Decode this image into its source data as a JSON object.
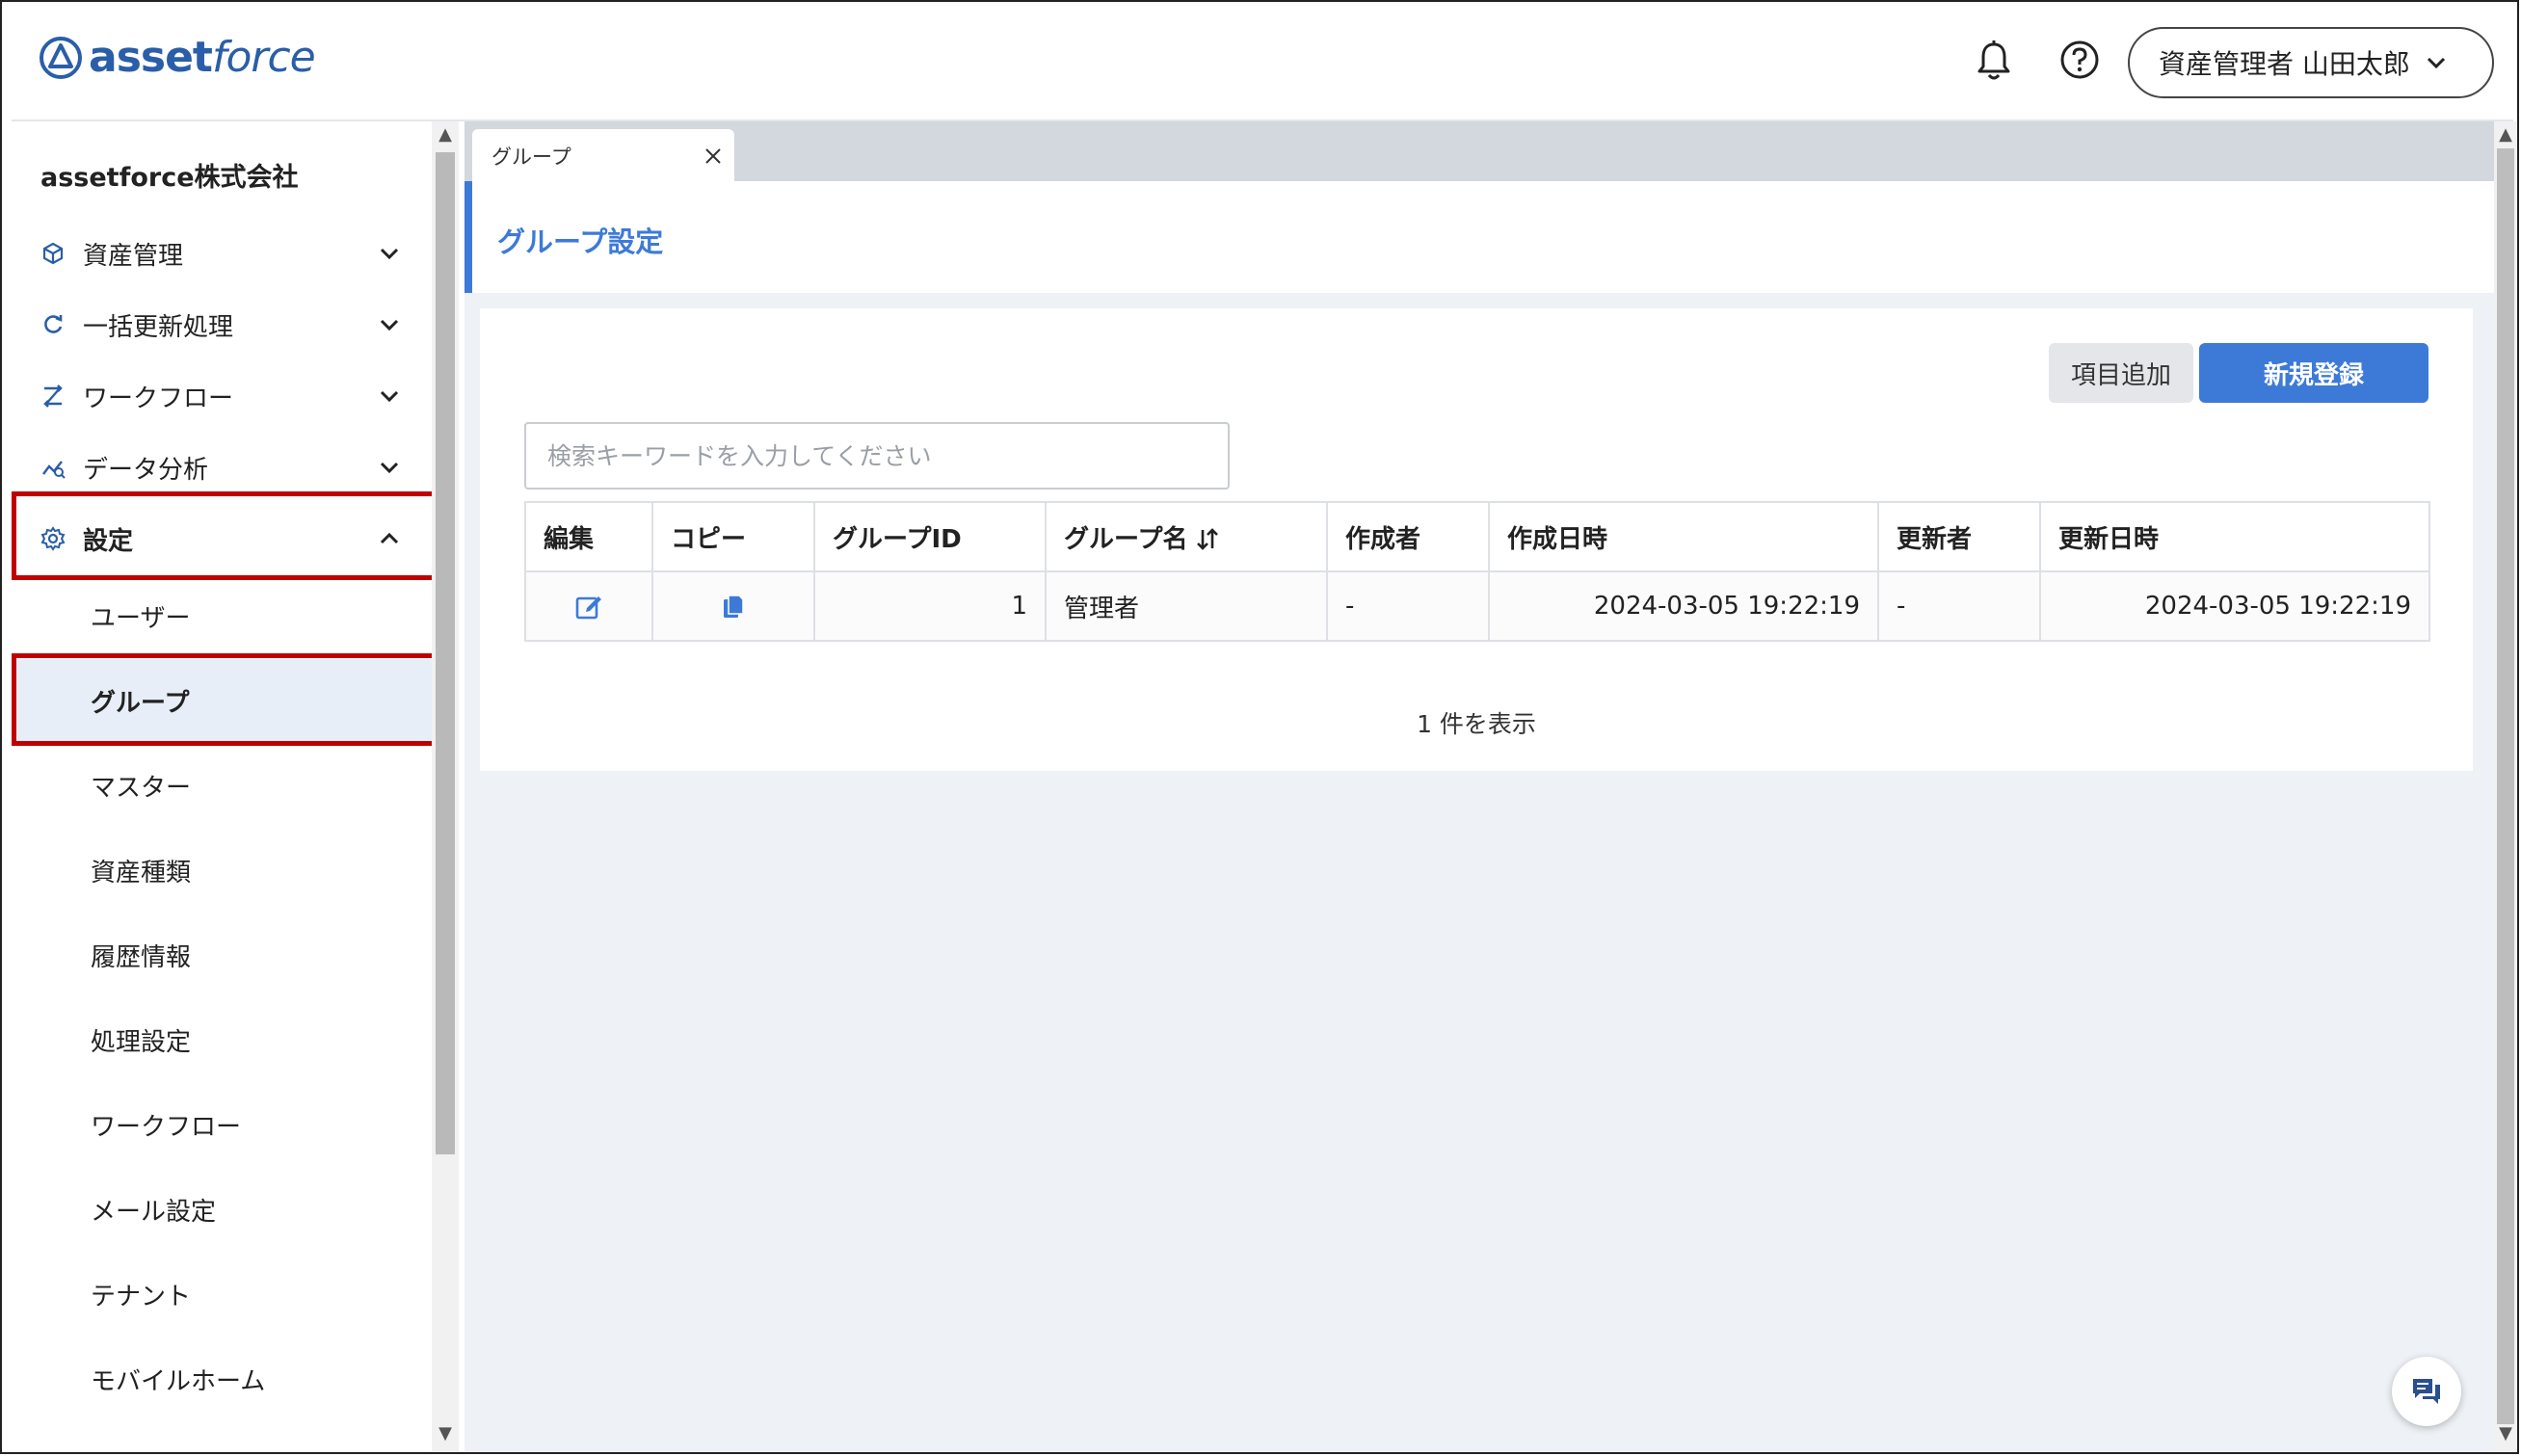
{
  "header": {
    "logo_part1": "asset",
    "logo_part2": "force",
    "user_label": "資産管理者 山田太郎"
  },
  "sidebar": {
    "company": "assetforce株式会社",
    "menu": [
      {
        "label": "資産管理",
        "icon": "cube-icon"
      },
      {
        "label": "一括更新処理",
        "icon": "refresh-icon"
      },
      {
        "label": "ワークフロー",
        "icon": "workflow-icon"
      },
      {
        "label": "データ分析",
        "icon": "analytics-icon"
      },
      {
        "label": "設定",
        "icon": "gear-icon",
        "expanded": true
      }
    ],
    "settings_items": [
      {
        "label": "ユーザー"
      },
      {
        "label": "グループ",
        "active": true
      },
      {
        "label": "マスター"
      },
      {
        "label": "資産種類"
      },
      {
        "label": "履歴情報"
      },
      {
        "label": "処理設定"
      },
      {
        "label": "ワークフロー"
      },
      {
        "label": "メール設定"
      },
      {
        "label": "テナント"
      },
      {
        "label": "モバイルホーム"
      }
    ]
  },
  "tabs": [
    {
      "label": "グループ"
    }
  ],
  "page": {
    "title": "グループ設定",
    "add_field_button": "項目追加",
    "new_button": "新規登録",
    "search_placeholder": "検索キーワードを入力してください",
    "result_count": "1 件を表示"
  },
  "table": {
    "columns": [
      "編集",
      "コピー",
      "グループID",
      "グループ名",
      "作成者",
      "作成日時",
      "更新者",
      "更新日時"
    ],
    "rows": [
      {
        "id": "1",
        "name": "管理者",
        "creator": "-",
        "created_at": "2024-03-05 19:22:19",
        "updater": "-",
        "updated_at": "2024-03-05 19:22:19"
      }
    ]
  },
  "colors": {
    "brand": "#2a5ea8",
    "accent": "#3d7ad8",
    "highlight_box": "#c00000"
  }
}
